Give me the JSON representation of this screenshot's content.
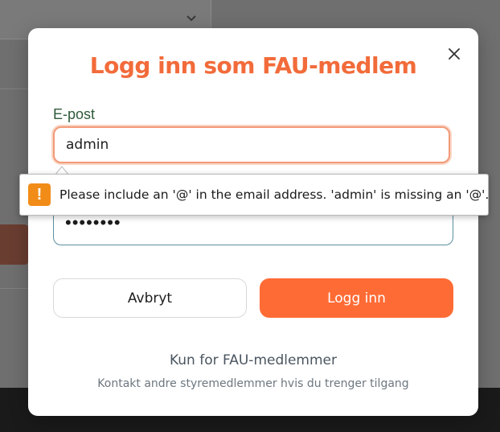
{
  "modal": {
    "title": "Logg inn som FAU-medlem",
    "email_label": "E-post",
    "email_value": "admin",
    "password_value": "••••••••",
    "cancel_label": "Avbryt",
    "login_label": "Logg inn",
    "footer_title": "Kun for FAU-medlemmer",
    "footer_subtitle": "Kontakt andre styremedlemmer hvis du trenger tilgang",
    "close_icon": "close-icon"
  },
  "validation": {
    "icon": "warning-icon",
    "glyph": "!",
    "message": "Please include an '@' in the email address. 'admin' is missing an '@'."
  },
  "colors": {
    "accent": "#ff6b35",
    "title": "#f26b3a",
    "label": "#2e5a3a",
    "warning": "#f28c18"
  }
}
